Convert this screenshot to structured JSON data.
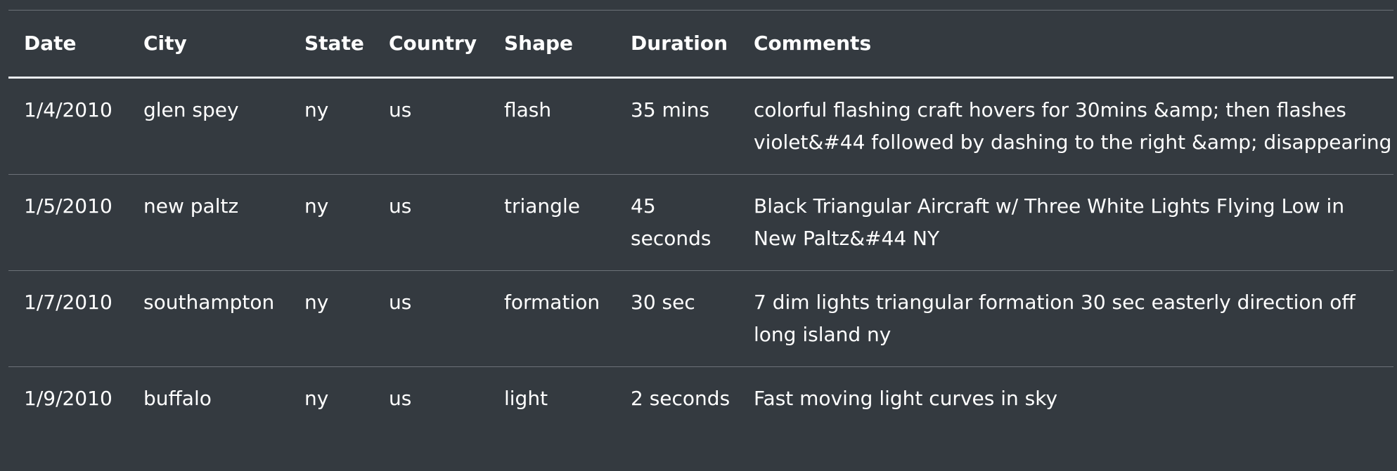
{
  "table": {
    "headers": [
      "Date",
      "City",
      "State",
      "Country",
      "Shape",
      "Duration",
      "Comments"
    ],
    "rows": [
      [
        "1/4/2010",
        "glen spey",
        "ny",
        "us",
        "flash",
        "35 mins",
        "colorful flashing craft hovers for 30mins &amp; then flashes violet&#44 followed by dashing to the right &amp; disappearing"
      ],
      [
        "1/5/2010",
        "new paltz",
        "ny",
        "us",
        "triangle",
        "45 seconds",
        "Black Triangular Aircraft w/ Three White Lights Flying Low in New Paltz&#44 NY"
      ],
      [
        "1/7/2010",
        "southampton",
        "ny",
        "us",
        "formation",
        "30 sec",
        "7 dim lights triangular formation 30 sec easterly direction off long island ny"
      ],
      [
        "1/9/2010",
        "buffalo",
        "ny",
        "us",
        "light",
        "2 seconds",
        "Fast moving light curves in sky"
      ]
    ]
  }
}
